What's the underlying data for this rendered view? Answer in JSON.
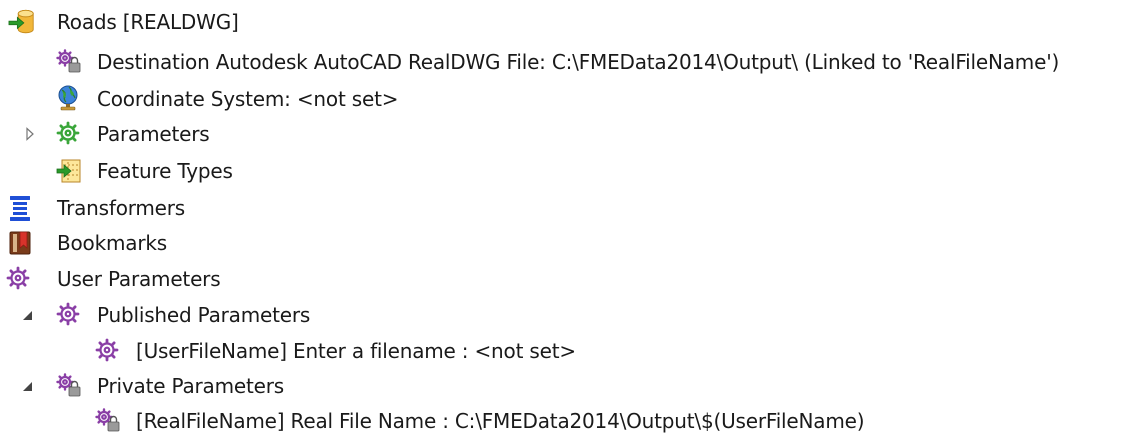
{
  "tree": {
    "writer": {
      "label": "Roads [REALDWG]",
      "icon": "writer-database-icon"
    },
    "destination": {
      "label": "Destination Autodesk AutoCAD RealDWG File: C:\\FMEData2014\\Output\\ (Linked to 'RealFileName')",
      "icon": "linked-gear-icon"
    },
    "coordinate_system": {
      "label": "Coordinate System: <not set>",
      "icon": "globe-icon"
    },
    "parameters": {
      "label": "Parameters",
      "icon": "green-gear-icon",
      "expanded": false
    },
    "feature_types": {
      "label": "Feature Types",
      "icon": "feature-types-icon"
    },
    "transformers": {
      "label": "Transformers",
      "icon": "transformers-icon"
    },
    "bookmarks": {
      "label": "Bookmarks",
      "icon": "bookmark-icon"
    },
    "user_parameters": {
      "label": "User Parameters",
      "icon": "purple-gear-icon"
    },
    "published_parameters": {
      "label": "Published Parameters",
      "icon": "purple-gear-icon",
      "expanded": true
    },
    "user_file_name": {
      "label": "[UserFileName] Enter a filename : <not set>",
      "icon": "purple-gear-icon"
    },
    "private_parameters": {
      "label": "Private Parameters",
      "icon": "private-gear-icon",
      "expanded": true
    },
    "real_file_name": {
      "label": "[RealFileName] Real File Name : C:\\FMEData2014\\Output\\$(UserFileName)",
      "icon": "private-gear-icon"
    }
  },
  "colors": {
    "text": "#1a1a1a",
    "purple_gear": "#8a3fa6",
    "green_gear": "#3aa63a",
    "blue_transformers": "#1f4fd6",
    "red_bookmark": "#c8332b",
    "green_arrow": "#2a9a2a",
    "yellow_db": "#f1b73a"
  }
}
